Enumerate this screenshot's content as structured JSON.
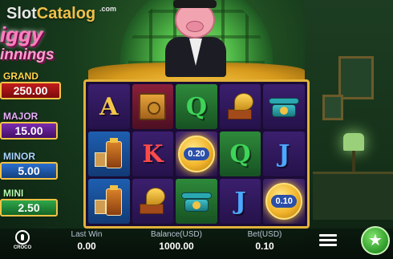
{
  "watermark": {
    "brand_slot": "Slot",
    "brand_catalog": "Catalog",
    "domain": ".com"
  },
  "game": {
    "title": "iggy",
    "subtitle": "innings"
  },
  "jackpots": [
    {
      "label": "GRAND",
      "value": "250.00"
    },
    {
      "label": "MAJOR",
      "value": "15.00"
    },
    {
      "label": "MINOR",
      "value": "5.00"
    },
    {
      "label": "MINI",
      "value": "2.50"
    }
  ],
  "reels": {
    "rows": [
      [
        {
          "symbol": "A"
        },
        {
          "symbol": "safe-icon"
        },
        {
          "symbol": "Q"
        },
        {
          "symbol": "gramophone-icon"
        },
        {
          "symbol": "telephone-icon"
        }
      ],
      [
        {
          "symbol": "whiskey-icon"
        },
        {
          "symbol": "K"
        },
        {
          "symbol": "coin",
          "value": "0.20"
        },
        {
          "symbol": "Q"
        },
        {
          "symbol": "J"
        }
      ],
      [
        {
          "symbol": "whiskey-icon"
        },
        {
          "symbol": "gramophone-icon"
        },
        {
          "symbol": "telephone-icon"
        },
        {
          "symbol": "J"
        },
        {
          "symbol": "coin",
          "value": "0.10"
        }
      ]
    ]
  },
  "bottom": {
    "provider": "CROCO",
    "last_win_label": "Last Win",
    "last_win_value": "0.00",
    "balance_label": "Balance(USD)",
    "balance_value": "1000.00",
    "bet_label": "Bet(USD)",
    "bet_value": "0.10"
  },
  "colors": {
    "reel_frame": "#e2b23a",
    "spin_button": "#2e9a2a",
    "grand": "#c21d1d"
  }
}
